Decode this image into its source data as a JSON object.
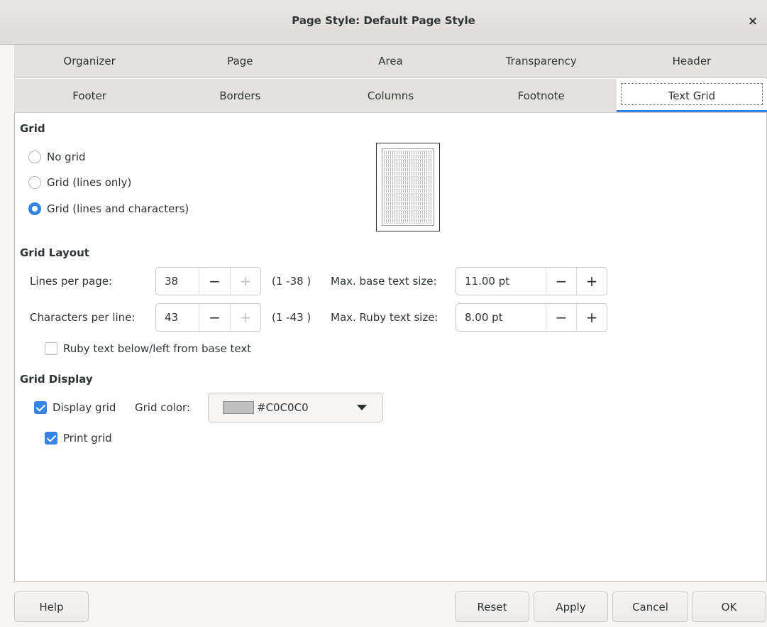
{
  "window": {
    "title": "Page Style: Default Page Style",
    "close_glyph": "×"
  },
  "tabs_row1": [
    "Organizer",
    "Page",
    "Area",
    "Transparency",
    "Header"
  ],
  "tabs_row2": [
    "Footer",
    "Borders",
    "Columns",
    "Footnote",
    "Text Grid"
  ],
  "active_tab": "Text Grid",
  "grid": {
    "section_title": "Grid",
    "options": [
      {
        "label": "No grid",
        "selected": false
      },
      {
        "label": "Grid (lines only)",
        "selected": false
      },
      {
        "label": "Grid (lines and characters)",
        "selected": true
      }
    ]
  },
  "layout": {
    "section_title": "Grid Layout",
    "lines_label": "Lines per page:",
    "lines_value": "38",
    "lines_range": "(1 -38 )",
    "chars_label": "Characters per line:",
    "chars_value": "43",
    "chars_range": "(1 -43 )",
    "base_label": "Max. base text size:",
    "base_value": "11.00 pt",
    "ruby_label": "Max. Ruby text size:",
    "ruby_value": "8.00 pt",
    "ruby_below_label": "Ruby text below/left from base text",
    "ruby_below_checked": false,
    "minus_glyph": "−",
    "plus_glyph": "+"
  },
  "display": {
    "section_title": "Grid Display",
    "display_grid_label": "Display grid",
    "display_grid_checked": true,
    "grid_color_label": "Grid color:",
    "grid_color_value": "#C0C0C0",
    "swatch_color": "#c0c0c0",
    "print_grid_label": "Print grid",
    "print_grid_checked": true
  },
  "buttons": {
    "help": "Help",
    "reset": "Reset",
    "apply": "Apply",
    "cancel": "Cancel",
    "ok": "OK"
  },
  "colors": {
    "accent": "#3584e4",
    "titlebar": "#dedbd8",
    "tab_bg": "#e4e2df"
  }
}
